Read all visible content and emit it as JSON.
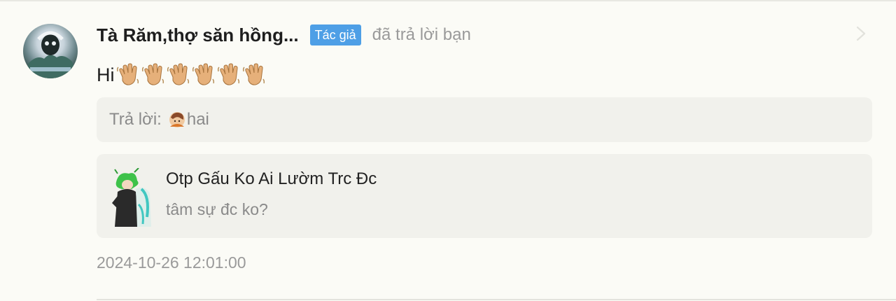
{
  "comment": {
    "author_name": "Tà Răm,thợ săn hồng...",
    "author_badge": "Tác giả",
    "reply_status": "đã trả lời bạn",
    "message_text": "Hi⁣",
    "emoji": [
      "waving-hand",
      "waving-hand",
      "waving-hand",
      "waving-hand",
      "waving-hand",
      "waving-hand"
    ],
    "reply": {
      "label": "Trả lời:",
      "target_name": "hai"
    },
    "quoted_post": {
      "title": "Otp Gấu Ko Ai Lườm Trc Đc",
      "text": "tâm sự đc ko?"
    },
    "timestamp": "2024-10-26 12:01:00"
  },
  "colors": {
    "background": "#fbfbf6",
    "badge": "#4e9fe6",
    "card": "#f1f1ec",
    "muted_text": "#9a9a9a"
  },
  "icons": {
    "chevron": "chevron-right-icon",
    "reply_avatar": "user-avatar-icon"
  }
}
